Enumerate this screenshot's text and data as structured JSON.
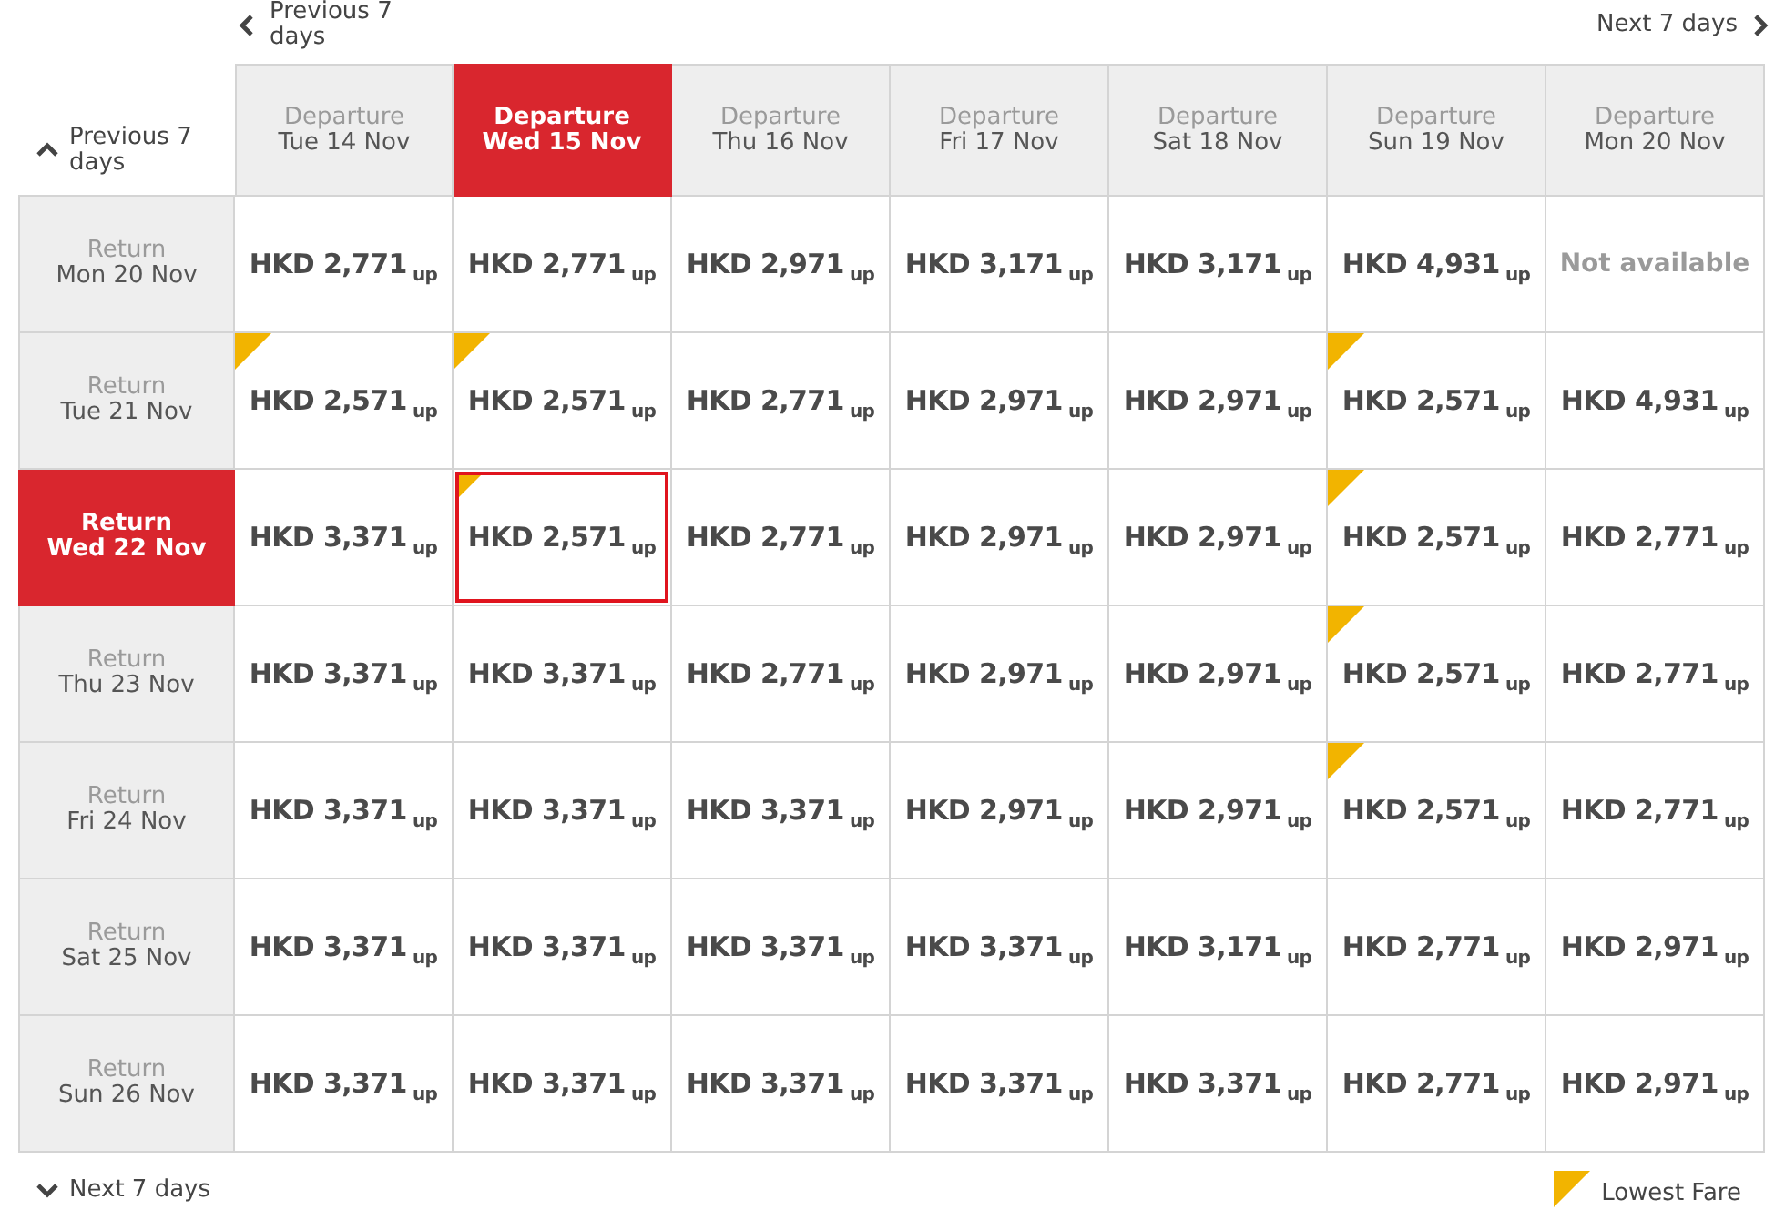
{
  "nav": {
    "previous_departures": "Previous 7 days",
    "next_departures": "Next 7 days",
    "previous_returns": "Previous 7 days",
    "next_returns": "Next 7 days"
  },
  "departures": [
    {
      "label": "Departure",
      "date": "Tue 14 Nov",
      "selected": false
    },
    {
      "label": "Departure",
      "date": "Wed 15 Nov",
      "selected": true
    },
    {
      "label": "Departure",
      "date": "Thu 16 Nov",
      "selected": false
    },
    {
      "label": "Departure",
      "date": "Fri 17 Nov",
      "selected": false
    },
    {
      "label": "Departure",
      "date": "Sat 18 Nov",
      "selected": false
    },
    {
      "label": "Departure",
      "date": "Sun 19 Nov",
      "selected": false
    },
    {
      "label": "Departure",
      "date": "Mon 20 Nov",
      "selected": false
    }
  ],
  "rows": [
    {
      "label": "Return",
      "date": "Mon 20 Nov",
      "selected": false,
      "cells": [
        {
          "kind": "fare",
          "price": "HKD 2,771",
          "suffix": "up",
          "lowest": false,
          "selected": false
        },
        {
          "kind": "fare",
          "price": "HKD 2,771",
          "suffix": "up",
          "lowest": false,
          "selected": false
        },
        {
          "kind": "fare",
          "price": "HKD 2,971",
          "suffix": "up",
          "lowest": false,
          "selected": false
        },
        {
          "kind": "fare",
          "price": "HKD 3,171",
          "suffix": "up",
          "lowest": false,
          "selected": false
        },
        {
          "kind": "fare",
          "price": "HKD 3,171",
          "suffix": "up",
          "lowest": false,
          "selected": false
        },
        {
          "kind": "fare",
          "price": "HKD 4,931",
          "suffix": "up",
          "lowest": false,
          "selected": false
        },
        {
          "kind": "unavailable",
          "text": "Not available"
        }
      ]
    },
    {
      "label": "Return",
      "date": "Tue 21 Nov",
      "selected": false,
      "cells": [
        {
          "kind": "fare",
          "price": "HKD 2,571",
          "suffix": "up",
          "lowest": true,
          "selected": false
        },
        {
          "kind": "fare",
          "price": "HKD 2,571",
          "suffix": "up",
          "lowest": true,
          "selected": false
        },
        {
          "kind": "fare",
          "price": "HKD 2,771",
          "suffix": "up",
          "lowest": false,
          "selected": false
        },
        {
          "kind": "fare",
          "price": "HKD 2,971",
          "suffix": "up",
          "lowest": false,
          "selected": false
        },
        {
          "kind": "fare",
          "price": "HKD 2,971",
          "suffix": "up",
          "lowest": false,
          "selected": false
        },
        {
          "kind": "fare",
          "price": "HKD 2,571",
          "suffix": "up",
          "lowest": true,
          "selected": false
        },
        {
          "kind": "fare",
          "price": "HKD 4,931",
          "suffix": "up",
          "lowest": false,
          "selected": false
        }
      ]
    },
    {
      "label": "Return",
      "date": "Wed 22 Nov",
      "selected": true,
      "cells": [
        {
          "kind": "fare",
          "price": "HKD 3,371",
          "suffix": "up",
          "lowest": false,
          "selected": false
        },
        {
          "kind": "fare",
          "price": "HKD 2,571",
          "suffix": "up",
          "lowest": true,
          "selected": true
        },
        {
          "kind": "fare",
          "price": "HKD 2,771",
          "suffix": "up",
          "lowest": false,
          "selected": false
        },
        {
          "kind": "fare",
          "price": "HKD 2,971",
          "suffix": "up",
          "lowest": false,
          "selected": false
        },
        {
          "kind": "fare",
          "price": "HKD 2,971",
          "suffix": "up",
          "lowest": false,
          "selected": false
        },
        {
          "kind": "fare",
          "price": "HKD 2,571",
          "suffix": "up",
          "lowest": true,
          "selected": false
        },
        {
          "kind": "fare",
          "price": "HKD 2,771",
          "suffix": "up",
          "lowest": false,
          "selected": false
        }
      ]
    },
    {
      "label": "Return",
      "date": "Thu 23 Nov",
      "selected": false,
      "cells": [
        {
          "kind": "fare",
          "price": "HKD 3,371",
          "suffix": "up",
          "lowest": false,
          "selected": false
        },
        {
          "kind": "fare",
          "price": "HKD 3,371",
          "suffix": "up",
          "lowest": false,
          "selected": false
        },
        {
          "kind": "fare",
          "price": "HKD 2,771",
          "suffix": "up",
          "lowest": false,
          "selected": false
        },
        {
          "kind": "fare",
          "price": "HKD 2,971",
          "suffix": "up",
          "lowest": false,
          "selected": false
        },
        {
          "kind": "fare",
          "price": "HKD 2,971",
          "suffix": "up",
          "lowest": false,
          "selected": false
        },
        {
          "kind": "fare",
          "price": "HKD 2,571",
          "suffix": "up",
          "lowest": true,
          "selected": false
        },
        {
          "kind": "fare",
          "price": "HKD 2,771",
          "suffix": "up",
          "lowest": false,
          "selected": false
        }
      ]
    },
    {
      "label": "Return",
      "date": "Fri 24 Nov",
      "selected": false,
      "cells": [
        {
          "kind": "fare",
          "price": "HKD 3,371",
          "suffix": "up",
          "lowest": false,
          "selected": false
        },
        {
          "kind": "fare",
          "price": "HKD 3,371",
          "suffix": "up",
          "lowest": false,
          "selected": false
        },
        {
          "kind": "fare",
          "price": "HKD 3,371",
          "suffix": "up",
          "lowest": false,
          "selected": false
        },
        {
          "kind": "fare",
          "price": "HKD 2,971",
          "suffix": "up",
          "lowest": false,
          "selected": false
        },
        {
          "kind": "fare",
          "price": "HKD 2,971",
          "suffix": "up",
          "lowest": false,
          "selected": false
        },
        {
          "kind": "fare",
          "price": "HKD 2,571",
          "suffix": "up",
          "lowest": true,
          "selected": false
        },
        {
          "kind": "fare",
          "price": "HKD 2,771",
          "suffix": "up",
          "lowest": false,
          "selected": false
        }
      ]
    },
    {
      "label": "Return",
      "date": "Sat 25 Nov",
      "selected": false,
      "cells": [
        {
          "kind": "fare",
          "price": "HKD 3,371",
          "suffix": "up",
          "lowest": false,
          "selected": false
        },
        {
          "kind": "fare",
          "price": "HKD 3,371",
          "suffix": "up",
          "lowest": false,
          "selected": false
        },
        {
          "kind": "fare",
          "price": "HKD 3,371",
          "suffix": "up",
          "lowest": false,
          "selected": false
        },
        {
          "kind": "fare",
          "price": "HKD 3,371",
          "suffix": "up",
          "lowest": false,
          "selected": false
        },
        {
          "kind": "fare",
          "price": "HKD 3,171",
          "suffix": "up",
          "lowest": false,
          "selected": false
        },
        {
          "kind": "fare",
          "price": "HKD 2,771",
          "suffix": "up",
          "lowest": false,
          "selected": false
        },
        {
          "kind": "fare",
          "price": "HKD 2,971",
          "suffix": "up",
          "lowest": false,
          "selected": false
        }
      ]
    },
    {
      "label": "Return",
      "date": "Sun 26 Nov",
      "selected": false,
      "cells": [
        {
          "kind": "fare",
          "price": "HKD 3,371",
          "suffix": "up",
          "lowest": false,
          "selected": false
        },
        {
          "kind": "fare",
          "price": "HKD 3,371",
          "suffix": "up",
          "lowest": false,
          "selected": false
        },
        {
          "kind": "fare",
          "price": "HKD 3,371",
          "suffix": "up",
          "lowest": false,
          "selected": false
        },
        {
          "kind": "fare",
          "price": "HKD 3,371",
          "suffix": "up",
          "lowest": false,
          "selected": false
        },
        {
          "kind": "fare",
          "price": "HKD 3,371",
          "suffix": "up",
          "lowest": false,
          "selected": false
        },
        {
          "kind": "fare",
          "price": "HKD 2,771",
          "suffix": "up",
          "lowest": false,
          "selected": false
        },
        {
          "kind": "fare",
          "price": "HKD 2,971",
          "suffix": "up",
          "lowest": false,
          "selected": false
        }
      ]
    }
  ],
  "legend": {
    "label": "Lowest Fare"
  }
}
